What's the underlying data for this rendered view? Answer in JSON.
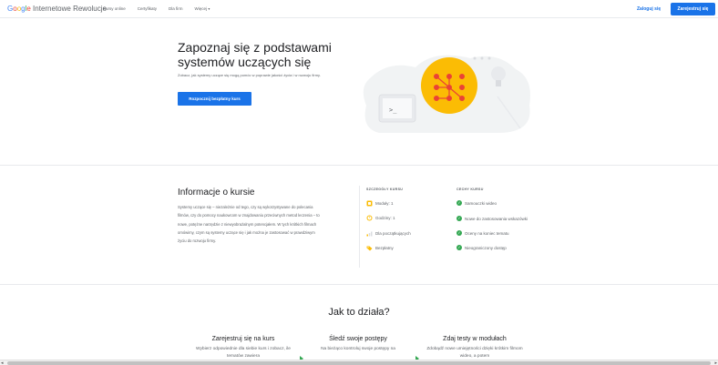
{
  "header": {
    "logo": {
      "g": "G",
      "o1": "o",
      "o2": "o",
      "g2": "g",
      "l": "l",
      "e": "e",
      "rest": " Internetowe Rewolucje"
    },
    "nav": [
      "Kursy online",
      "Certyfikaty",
      "Dla firm",
      "Więcej"
    ],
    "login": "Zaloguj się",
    "register": "Zarejestruj się"
  },
  "hero": {
    "title": "Zapoznaj się z podstawami systemów uczących się",
    "description": "Zobacz, jak systemy uczące się mogą pomóc w poprawie jakości życia i w rozwoju firmy.",
    "button": "Rozpocznij bezpłatny kurs"
  },
  "info": {
    "title": "Informacje o kursie",
    "text": "Systemy uczące się – niezależnie od tego, czy są wykorzystywane do polecania filmów, czy do pomocy naukowcom w znajdowaniu przeciwnych metod leczenia – to nowe, potężne narzędzie z niewyobrażalnym potencjałem. W tych krótkich filmach omówimy, czym są systemy uczące się i jak można je zastosować w prawdziwym życiu do rozwoju firmy.",
    "details_head": "SZCZEGÓŁY KURSU",
    "details": [
      {
        "icon": "modules-icon",
        "label": "Moduły: 1"
      },
      {
        "icon": "clock-icon",
        "label": "Godziny: 1"
      },
      {
        "icon": "level-icon",
        "label": "Dla początkujących"
      },
      {
        "icon": "price-tag-icon",
        "label": "Bezpłatny"
      }
    ],
    "features_head": "CECHY KURSU",
    "features": [
      "Samouczki wideo",
      "Nowe do zastosowania wskazówki",
      "Oceny na koniec tematu",
      "Nieograniczony dostęp"
    ]
  },
  "how": {
    "title": "Jak to działa?",
    "steps": [
      {
        "title": "Zarejestruj się na kurs",
        "text": "Wybierz odpowiednie dla siebie kurs i zobacz, ile tematów zawiera"
      },
      {
        "title": "Śledź swoje postępy",
        "text": "Na bieżąco kontroluj swoje postępy na "
      },
      {
        "title": "Zdaj testy w modułach",
        "text": "Zdobądź nowe umiejętności dzięki krótkim filmom wideo, a potem"
      }
    ]
  },
  "colors": {
    "accent": "#1a73e8",
    "check": "#34a853",
    "yellow": "#fbbc04",
    "red": "#ea4335"
  }
}
